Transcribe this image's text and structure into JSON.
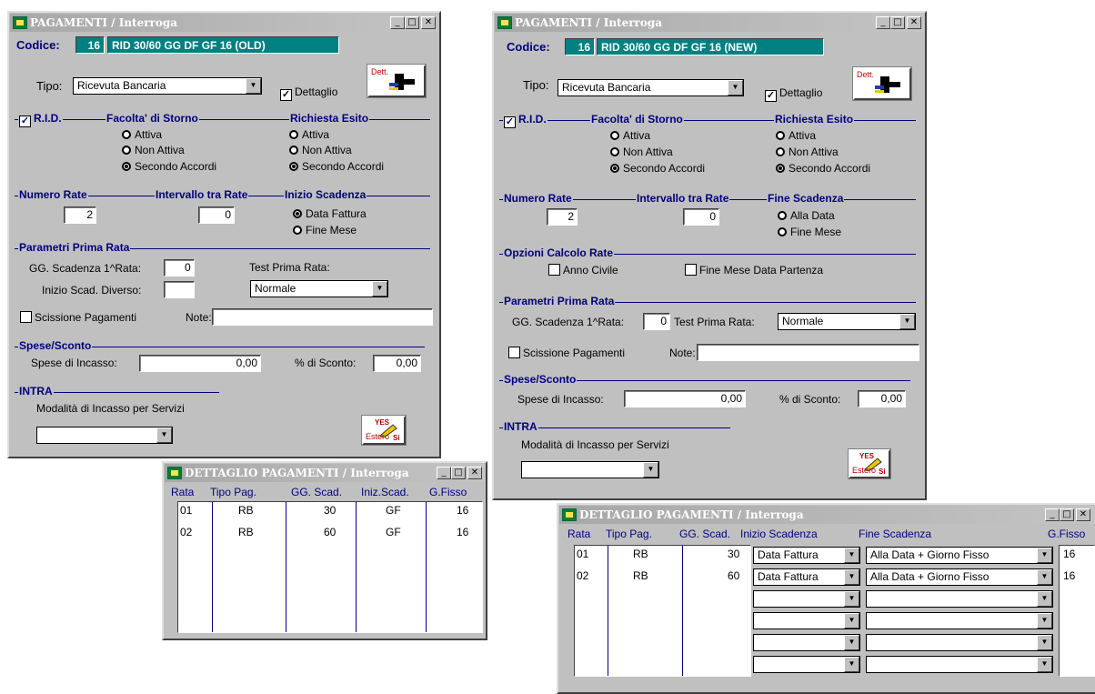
{
  "colors": {
    "window_bg": "#c0c0c0",
    "accent_teal": "#008080",
    "label_blue": "#000080"
  },
  "win1": {
    "title": "PAGAMENTI / Interroga",
    "codice_label": "Codice:",
    "codice_num": "16",
    "codice_desc": "RID 30/60 GG DF GF 16 (OLD)",
    "tipo_label": "Tipo:",
    "tipo_value": "Ricevuta Bancaria",
    "dettaglio_label": "Dettaglio",
    "dett_btn": "Dett.",
    "rid_label": "R.I.D.",
    "storno_title": "Facolta' di Storno",
    "esito_title": "Richiesta Esito",
    "attiva": "Attiva",
    "non_attiva": "Non Attiva",
    "secondo_accordi": "Secondo Accordi",
    "numero_rate_title": "Numero Rate",
    "numero_rate": "2",
    "intervallo_title": "Intervallo tra Rate",
    "intervallo": "0",
    "inizio_title": "Inizio Scadenza",
    "data_fattura": "Data Fattura",
    "fine_mese": "Fine Mese",
    "prima_rata_title": "Parametri Prima Rata",
    "gg_label": "GG. Scadenza 1^Rata:",
    "gg_value": "0",
    "inizio_diverso_label": "Inizio Scad. Diverso:",
    "test_label": "Test Prima Rata:",
    "test_value": "Normale",
    "scissione_label": "Scissione Pagamenti",
    "note_label": "Note:",
    "spese_title": "Spese/Sconto",
    "spese_label": "Spese di Incasso:",
    "spese_value": "0,00",
    "sconto_label": "% di Sconto:",
    "sconto_value": "0,00",
    "intra_title": "INTRA",
    "modalita_label": "Modalità di Incasso per Servizi",
    "estero_top": "YES",
    "estero_bottom": "Estero",
    "estero_si": "Si"
  },
  "win2": {
    "title": "PAGAMENTI / Interroga",
    "codice_label": "Codice:",
    "codice_num": "16",
    "codice_desc": "RID 30/60 GG DF GF 16 (NEW)",
    "tipo_label": "Tipo:",
    "tipo_value": "Ricevuta Bancaria",
    "dettaglio_label": "Dettaglio",
    "dett_btn": "Dett.",
    "rid_label": "R.I.D.",
    "storno_title": "Facolta' di Storno",
    "esito_title": "Richiesta Esito",
    "attiva": "Attiva",
    "non_attiva": "Non Attiva",
    "secondo_accordi": "Secondo Accordi",
    "numero_rate_title": "Numero Rate",
    "numero_rate": "2",
    "intervallo_title": "Intervallo tra Rate",
    "intervallo": "0",
    "fine_title": "Fine Scadenza",
    "alla_data": "Alla Data",
    "fine_mese": "Fine Mese",
    "opzioni_title": "Opzioni Calcolo Rate",
    "anno_civile": "Anno Civile",
    "fine_mese_partenza": "Fine Mese Data Partenza",
    "prima_rata_title": "Parametri Prima Rata",
    "gg_label": "GG. Scadenza 1^Rata:",
    "gg_value": "0",
    "test_label": "Test Prima Rata:",
    "test_value": "Normale",
    "scissione_label": "Scissione Pagamenti",
    "note_label": "Note:",
    "spese_title": "Spese/Sconto",
    "spese_label": "Spese di Incasso:",
    "spese_value": "0,00",
    "sconto_label": "% di Sconto:",
    "sconto_value": "0,00",
    "intra_title": "INTRA",
    "modalita_label": "Modalità di Incasso per Servizi",
    "estero_top": "YES",
    "estero_bottom": "Estero",
    "estero_si": "Si"
  },
  "det1": {
    "title": "DETTAGLIO PAGAMENTI / Interroga",
    "headers": [
      "Rata",
      "Tipo Pag.",
      "GG. Scad.",
      "Iniz.Scad.",
      "G.Fisso"
    ],
    "rows": [
      [
        "01",
        "RB",
        "30",
        "GF",
        "16"
      ],
      [
        "02",
        "RB",
        "60",
        "GF",
        "16"
      ]
    ]
  },
  "det2": {
    "title": "DETTAGLIO PAGAMENTI / Interroga",
    "headers": [
      "Rata",
      "Tipo Pag.",
      "GG. Scad.",
      "Inizio Scadenza",
      "Fine Scadenza",
      "G.Fisso"
    ],
    "rows": [
      [
        "01",
        "RB",
        "30",
        "Data Fattura",
        "Alla Data + Giorno Fisso",
        "16"
      ],
      [
        "02",
        "RB",
        "60",
        "Data Fattura",
        "Alla Data + Giorno Fisso",
        "16"
      ]
    ]
  }
}
